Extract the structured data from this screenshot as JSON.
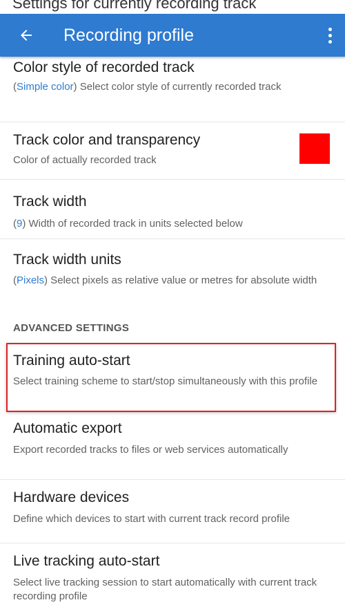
{
  "status_bar": {
    "partial_text": "Settings for currently recording track"
  },
  "app_bar": {
    "title": "Recording profile",
    "back_icon": "arrow-left-icon",
    "overflow_icon": "more-vertical-icon",
    "color": "#2e7bd0"
  },
  "preferences": [
    {
      "title": "Color style of recorded track",
      "value": "Simple color",
      "summary": " Select color style of currently recorded track"
    },
    {
      "title": "Track color and transparency",
      "summary": "Color of actually recorded track",
      "swatch_color": "#ff0000"
    },
    {
      "title": "Track width",
      "value": "9",
      "summary": " Width of recorded track in units selected below"
    },
    {
      "title": "Track width units",
      "value": "Pixels",
      "summary": " Select pixels as relative value or metres for absolute width"
    }
  ],
  "section_header": "ADVANCED SETTINGS",
  "advanced": [
    {
      "title": "Training auto-start",
      "summary": "Select training scheme to start/stop simultaneously with this profile",
      "highlighted": true,
      "highlight_color": "#e02020"
    },
    {
      "title": "Automatic export",
      "summary": "Export recorded tracks to files or web services automatically"
    },
    {
      "title": "Hardware devices",
      "summary": "Define which devices to start with current track record profile"
    },
    {
      "title": "Live tracking auto-start",
      "summary": "Select live tracking session to start automatically with current track recording profile"
    }
  ]
}
